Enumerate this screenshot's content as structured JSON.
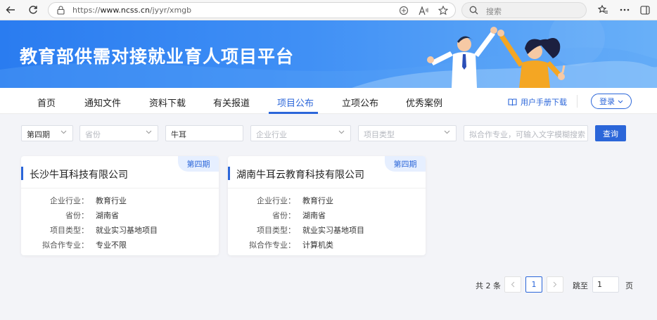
{
  "browser": {
    "url_prefix": "https://",
    "url_host": "www.ncss.cn",
    "url_path": "/jyyr/xmgb",
    "search_placeholder": "搜索"
  },
  "banner": {
    "title": "教育部供需对接就业育人项目平台"
  },
  "nav": {
    "items": [
      "首页",
      "通知文件",
      "资料下载",
      "有关报道",
      "项目公布",
      "立项公布",
      "优秀案例"
    ],
    "active": "项目公布",
    "manual_label": "用户手册下载",
    "login_label": "登录"
  },
  "filters": {
    "period": "第四期",
    "province_placeholder": "省份",
    "keyword": "牛耳",
    "industry_placeholder": "企业行业",
    "project_type_placeholder": "项目类型",
    "major_placeholder": "拟合作专业，可输入文字模糊搜索",
    "query_label": "查询"
  },
  "cards": [
    {
      "company": "长沙牛耳科技有限公司",
      "tag": "第四期",
      "fields": [
        {
          "label": "企业行业：",
          "value": "教育行业"
        },
        {
          "label": "省份：",
          "value": "湖南省"
        },
        {
          "label": "项目类型：",
          "value": "就业实习基地项目"
        },
        {
          "label": "拟合作专业：",
          "value": "专业不限"
        }
      ]
    },
    {
      "company": "湖南牛耳云教育科技有限公司",
      "tag": "第四期",
      "fields": [
        {
          "label": "企业行业：",
          "value": "教育行业"
        },
        {
          "label": "省份：",
          "value": "湖南省"
        },
        {
          "label": "项目类型：",
          "value": "就业实习基地项目"
        },
        {
          "label": "拟合作专业：",
          "value": "计算机类"
        }
      ]
    }
  ],
  "pagination": {
    "total_text": "共 2 条",
    "current_page": "1",
    "jump_label": "跳至",
    "jump_value": "1",
    "page_label": "页"
  },
  "colors": {
    "brand": "#2b66d9",
    "banner_start": "#2a7cf0",
    "banner_end": "#69b0f8"
  }
}
